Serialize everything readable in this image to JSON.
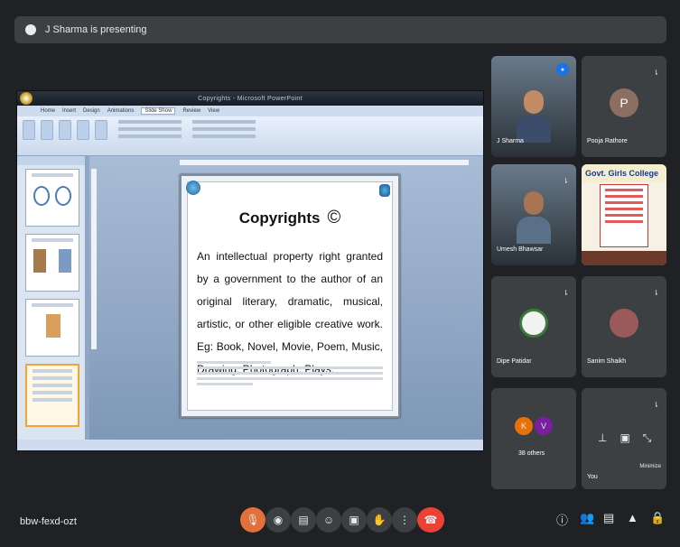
{
  "banner": {
    "text": "J Sharma is presenting"
  },
  "presentation": {
    "window_title": "Copyrights - Microsoft PowerPoint",
    "tabs": [
      "Home",
      "Insert",
      "Design",
      "Animations",
      "Slide Show",
      "Review",
      "View"
    ],
    "active_tab": "Slide Show",
    "slide": {
      "title": "Copyrights",
      "symbol": "©",
      "body": "An intellectual property right granted by a government to the author of an original literary, dramatic, musical, artistic, or other eligible creative work. Eg: Book, Novel, Movie, Poem, Music, Drawing, Photograph, Plays."
    }
  },
  "participants": [
    {
      "name": "J Sharma",
      "type": "video"
    },
    {
      "name": "Pooja Rathore",
      "type": "avatar",
      "initial": "P",
      "color": "#8d6e63"
    },
    {
      "name": "Umesh Bhawsar",
      "type": "video"
    },
    {
      "name": "Govt. Girls College",
      "type": "poster"
    },
    {
      "name": "Dipe Patidar",
      "type": "photo-avatar"
    },
    {
      "name": "Sanim Shaikh",
      "type": "photo-avatar"
    },
    {
      "name": "38 others",
      "type": "others",
      "initials": [
        "K",
        "V"
      ]
    },
    {
      "name": "You",
      "type": "self",
      "note": "Minimize"
    }
  ],
  "meeting": {
    "code": "bbw-fexd-ozt"
  },
  "controls": [
    "mic",
    "camera",
    "captions",
    "emoji",
    "present",
    "raise-hand",
    "more",
    "end-call"
  ],
  "right_controls": [
    "info",
    "people",
    "chat",
    "activities",
    "lock"
  ]
}
